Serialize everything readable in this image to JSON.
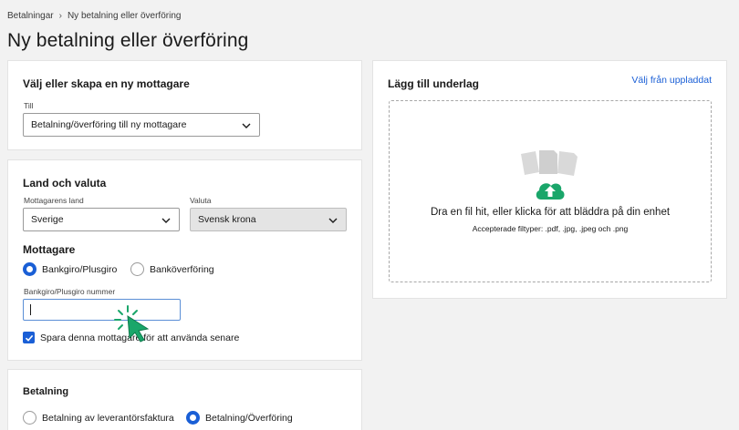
{
  "breadcrumb": {
    "parent": "Betalningar",
    "separator": "›",
    "current": "Ny betalning eller överföring"
  },
  "page_title": "Ny betalning eller överföring",
  "recipient_card": {
    "heading": "Välj eller skapa en ny mottagare",
    "to_label": "Till",
    "to_value": "Betalning/överföring till ny mottagare"
  },
  "country_card": {
    "heading": "Land och valuta",
    "country_label": "Mottagarens land",
    "country_value": "Sverige",
    "currency_label": "Valuta",
    "currency_value": "Svensk krona",
    "recipient_heading": "Mottagare",
    "option_bankgiro": "Bankgiro/Plusgiro",
    "option_bank_transfer": "Banköverföring",
    "selected_option": "Bankgiro/Plusgiro",
    "number_label": "Bankgiro/Plusgiro nummer",
    "number_value": "",
    "save_label": "Spara denna mottagare för att använda senare",
    "save_checked": true
  },
  "payment_card": {
    "heading": "Betalning",
    "option_invoice": "Betalning av leverantörsfaktura",
    "option_transfer": "Betalning/Överföring",
    "selected_option": "Betalning/Överföring"
  },
  "attachment_card": {
    "heading": "Lägg till underlag",
    "link": "Välj från uppladdat",
    "drop_title": "Dra en fil hit, eller klicka för att bläddra på din enhet",
    "drop_subtitle": "Accepterade filtyper: .pdf, .jpg, .jpeg och .png",
    "upload_icon": "cloud-upload-icon"
  },
  "colors": {
    "accent": "#1a5fd6",
    "upload_green": "#1aa66a",
    "cursor_green": "#1aa66a"
  }
}
